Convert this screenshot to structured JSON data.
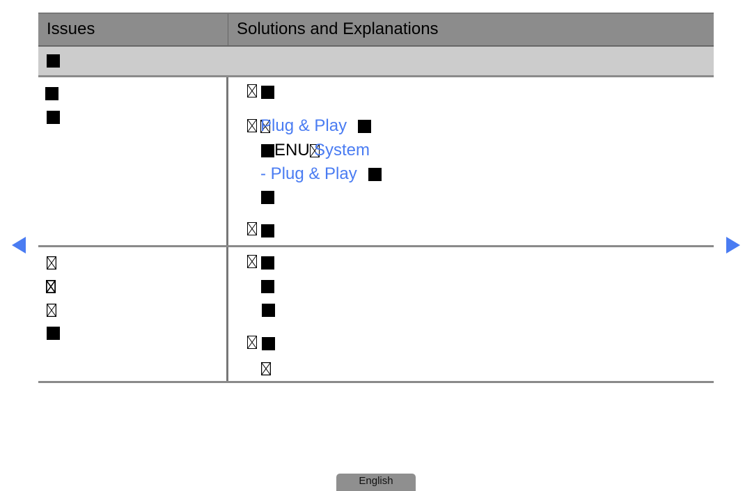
{
  "table": {
    "header": {
      "issues": "Issues",
      "solutions": "Solutions and Explanations"
    },
    "section_title_glyph": "■",
    "rows": [
      {
        "issue_lines": [
          "■",
          "■"
        ],
        "solutions": {
          "line1": {
            "bullet": "☒",
            "text": "■"
          },
          "line2": {
            "bullet": "☒",
            "prefix": "☒",
            "link": "Plug & Play",
            "suffix": "■"
          },
          "line3": {
            "prefix": "■",
            "plain": "ENU",
            "glyph": "☒",
            "link": "System"
          },
          "line4": {
            "link": "- Plug & Play",
            "suffix": "■"
          },
          "line5": {
            "text": "■"
          },
          "line6": {
            "bullet": "☒",
            "text": "■"
          }
        }
      },
      {
        "issue_lines": [
          "☒",
          "☒",
          "☒",
          "■"
        ],
        "solutions": {
          "line1": {
            "bullet": "☒",
            "text": "■"
          },
          "line2": {
            "text": "■"
          },
          "line3": {
            "text": "■"
          },
          "line4": {
            "bullet": "☒",
            "text": "■"
          },
          "line5": {
            "text": "☒"
          }
        }
      }
    ]
  },
  "navigation": {
    "prev_icon": "triangle-left",
    "next_icon": "triangle-right"
  },
  "language_tab": {
    "label": "English"
  },
  "colors": {
    "header_bg": "#8c8c8c",
    "section_bg": "#cccccc",
    "link_blue": "#4a7cf2",
    "nav_arrow": "#4a7cf2",
    "language_tab_bg": "#8f8f8f"
  }
}
